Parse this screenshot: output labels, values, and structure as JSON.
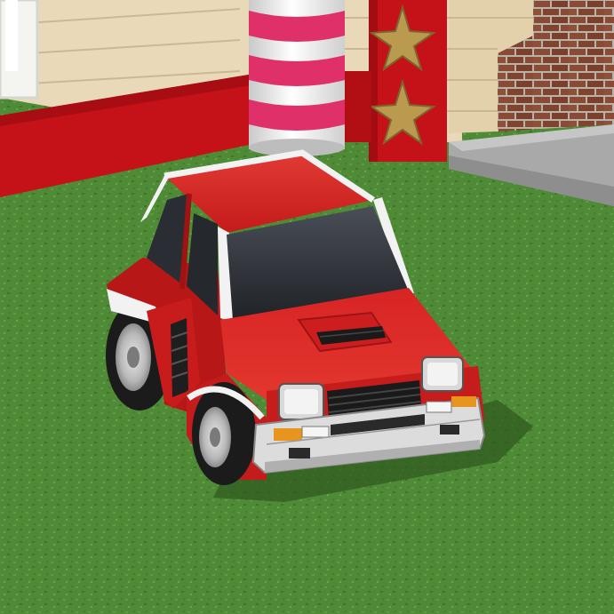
{
  "scene": {
    "kind": "3d-game-render",
    "subject": "red-hatchback-toy-car",
    "colors": {
      "grass": "#4f8a36",
      "grass_dark": "#3a6e28",
      "car_red": "#d41f1f",
      "car_red_dark": "#9e1414",
      "trim_white": "#f2f2f2",
      "window": "#2a2d33",
      "wall_cream": "#e9d9b9",
      "wall_red": "#c51118",
      "pole_pink": "#e0306a",
      "brick": "#8a4a35",
      "star_gold": "#b99a4e",
      "sidewalk": "#a9a9a9"
    }
  }
}
